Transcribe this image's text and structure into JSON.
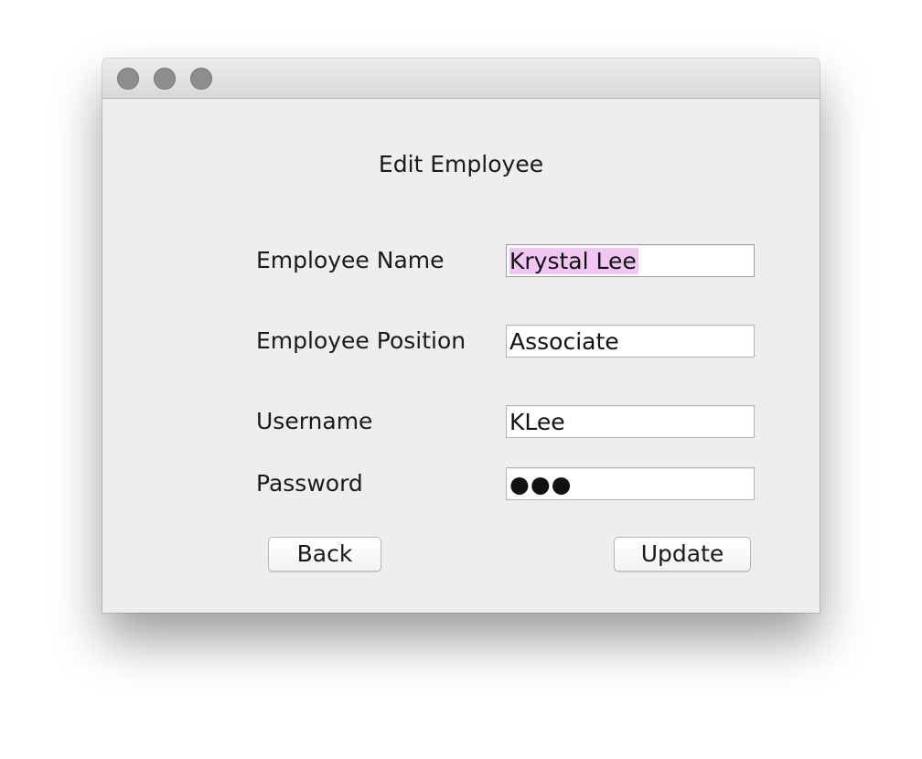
{
  "window": {
    "title_text": "",
    "controls": [
      "close-button",
      "minimize-button",
      "zoom-button"
    ]
  },
  "form": {
    "title": "Edit Employee",
    "fields": [
      {
        "label": "Employee Name",
        "value": "Krystal Lee",
        "selected": true
      },
      {
        "label": "Employee Position",
        "value": "Associate"
      },
      {
        "label": "Username",
        "value": "KLee"
      },
      {
        "label": "Password",
        "value": "●●●",
        "type": "password"
      }
    ]
  },
  "buttons": {
    "back_label": "Back",
    "update_label": "Update"
  },
  "colors": {
    "window_bg": "#eeeeee",
    "selection_highlight": "#f1c6f4",
    "traffic_light": "#8e8e91"
  }
}
